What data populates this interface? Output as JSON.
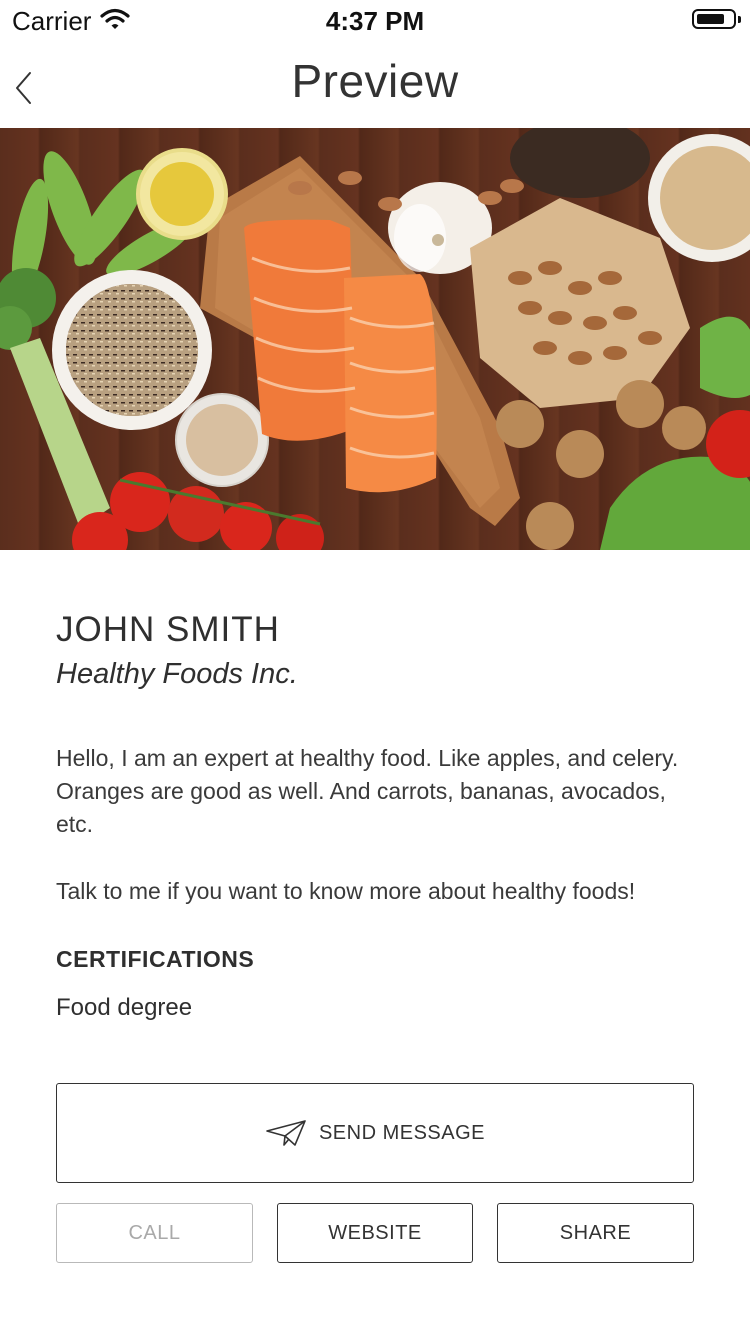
{
  "status_bar": {
    "carrier": "Carrier",
    "time": "4:37 PM",
    "battery_level": 0.8
  },
  "nav": {
    "title": "Preview",
    "back_icon": "chevron-left-icon"
  },
  "hero": {
    "image": "healthy-foods-photo"
  },
  "profile": {
    "name": "JOHN SMITH",
    "company": "Healthy Foods Inc.",
    "bio": "Hello, I am an expert at healthy food. Like apples, and celery. Oranges are good as well. And carrots, bananas, avocados, etc.",
    "bio_2": "Talk to me if you want to know more about healthy foods!",
    "certifications_heading": "CERTIFICATIONS",
    "certifications": [
      "Food degree"
    ]
  },
  "actions": {
    "send_message": "SEND MESSAGE",
    "send_icon": "paper-plane-icon",
    "call": "CALL",
    "website": "WEBSITE",
    "share": "SHARE"
  },
  "colors": {
    "text": "#333333",
    "disabled": "#a9a9a9",
    "background": "#ffffff"
  }
}
